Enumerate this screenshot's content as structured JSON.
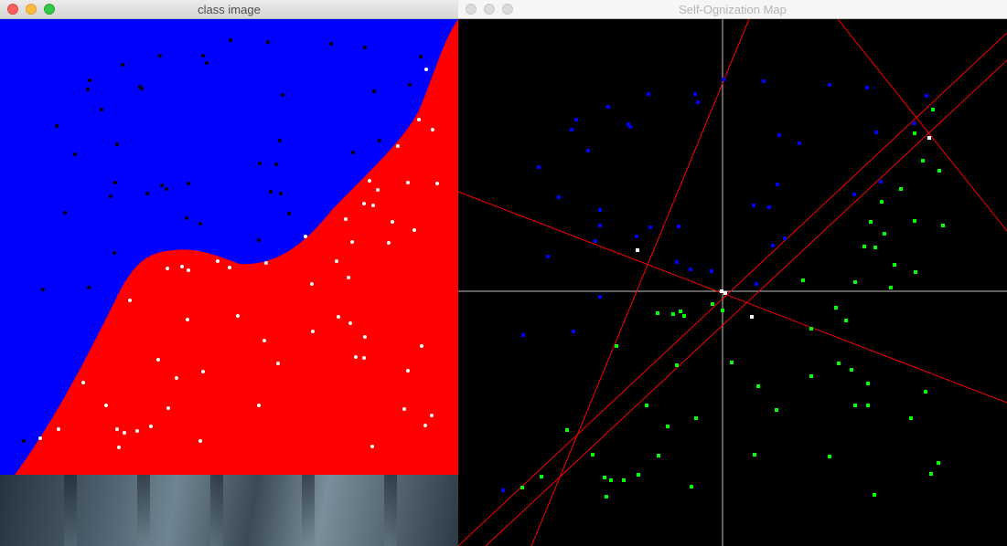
{
  "windows": {
    "class_image": {
      "title": "class image",
      "active": true,
      "colors": {
        "class_a_region": "#0000ff",
        "class_b_region": "#ff0000",
        "class_a_point": "#000000",
        "class_b_point": "#ffffff"
      }
    },
    "som": {
      "title": "Self-Ognization Map",
      "active": false,
      "colors": {
        "background": "#000000",
        "axes": "#ffffff",
        "lines": "#ff0000",
        "class_a_point": "#0000ff",
        "class_b_point": "#00ff00",
        "neuron": "#ffffff"
      }
    }
  }
}
